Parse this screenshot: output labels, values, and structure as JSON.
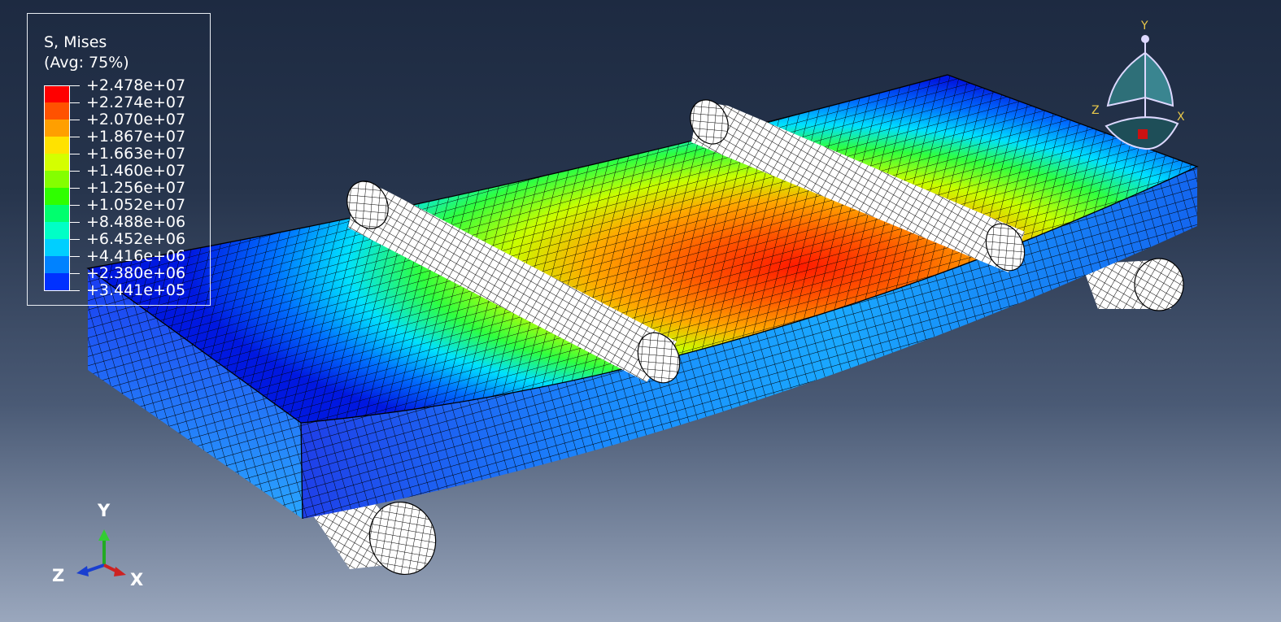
{
  "legend": {
    "title": "S, Mises",
    "subtitle": "(Avg: 75%)",
    "levels": [
      {
        "label": "+2.478e+07",
        "color": "#ff0000"
      },
      {
        "label": "+2.274e+07",
        "color": "#ff5200"
      },
      {
        "label": "+2.070e+07",
        "color": "#ff9f00"
      },
      {
        "label": "+1.867e+07",
        "color": "#ffe200"
      },
      {
        "label": "+1.663e+07",
        "color": "#d4ff00"
      },
      {
        "label": "+1.460e+07",
        "color": "#84ff00"
      },
      {
        "label": "+1.256e+07",
        "color": "#2fff00"
      },
      {
        "label": "+1.052e+07",
        "color": "#00ff6e"
      },
      {
        "label": "+8.488e+06",
        "color": "#00ffc6"
      },
      {
        "label": "+6.452e+06",
        "color": "#00cfff"
      },
      {
        "label": "+4.416e+06",
        "color": "#0082ff"
      },
      {
        "label": "+2.380e+06",
        "color": "#0031ff"
      },
      {
        "label": "+3.441e+05",
        "color": null
      }
    ]
  },
  "triad": {
    "y": "Y",
    "z": "Z",
    "x": "X"
  },
  "view_cube": {
    "y": "Y",
    "z": "Z",
    "x": "X"
  },
  "colors": {
    "background_top": "#1d2a41",
    "background_bottom": "#9aa7bd",
    "mesh_edges": "#000000",
    "roller_fill": "#ffffff",
    "axis_y": "#22aa22",
    "axis_x": "#cc2222",
    "axis_z": "#1a3fd0",
    "view_cube_fill": "#2e6f78",
    "view_cube_marker": "#cc1111"
  }
}
